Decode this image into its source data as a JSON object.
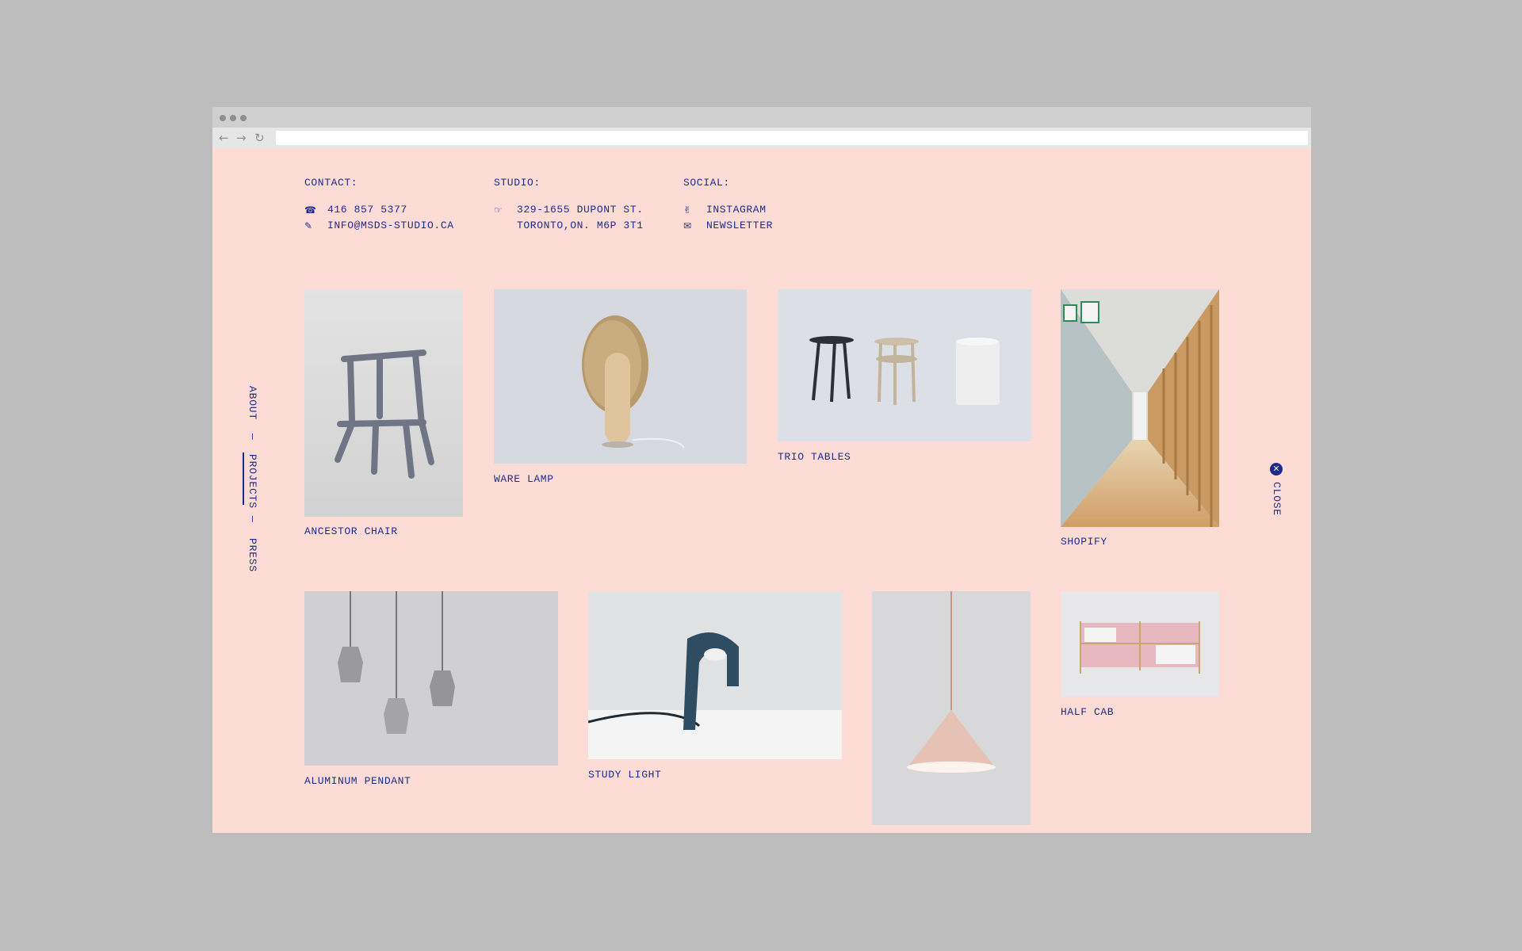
{
  "contact": {
    "heading": "CONTACT:",
    "phone": "416 857 5377",
    "email": "INFO@MSDS-STUDIO.CA",
    "phone_icon": "phone-icon",
    "email_icon": "pencil-icon"
  },
  "studio": {
    "heading": "STUDIO:",
    "address_line1": "329-1655 DUPONT ST.",
    "address_line2": "TORONTO,ON. M6P 3T1",
    "icon": "pointing-hand-icon"
  },
  "social": {
    "heading": "SOCIAL:",
    "instagram": "INSTAGRAM",
    "newsletter": "NEWSLETTER",
    "instagram_icon": "hand-icon",
    "newsletter_icon": "envelope-icon"
  },
  "nav": {
    "about": "ABOUT",
    "sep1": "—",
    "projects": "PROJECTS",
    "sep2": "—",
    "press": "PRESS",
    "active": "projects"
  },
  "close": {
    "label": "CLOSE",
    "icon": "close-icon"
  },
  "projects": [
    {
      "caption": "ANCESTOR CHAIR"
    },
    {
      "caption": "WARE LAMP"
    },
    {
      "caption": "TRIO TABLES"
    },
    {
      "caption": "SHOPIFY"
    },
    {
      "caption": "ALUMINUM PENDANT"
    },
    {
      "caption": "STUDY LIGHT"
    },
    {
      "caption": ""
    },
    {
      "caption": "HALF CAB"
    }
  ],
  "colors": {
    "page_background": "#fddcd6",
    "ink": "#1d2b8c",
    "outer_background": "#bdbdbd"
  }
}
